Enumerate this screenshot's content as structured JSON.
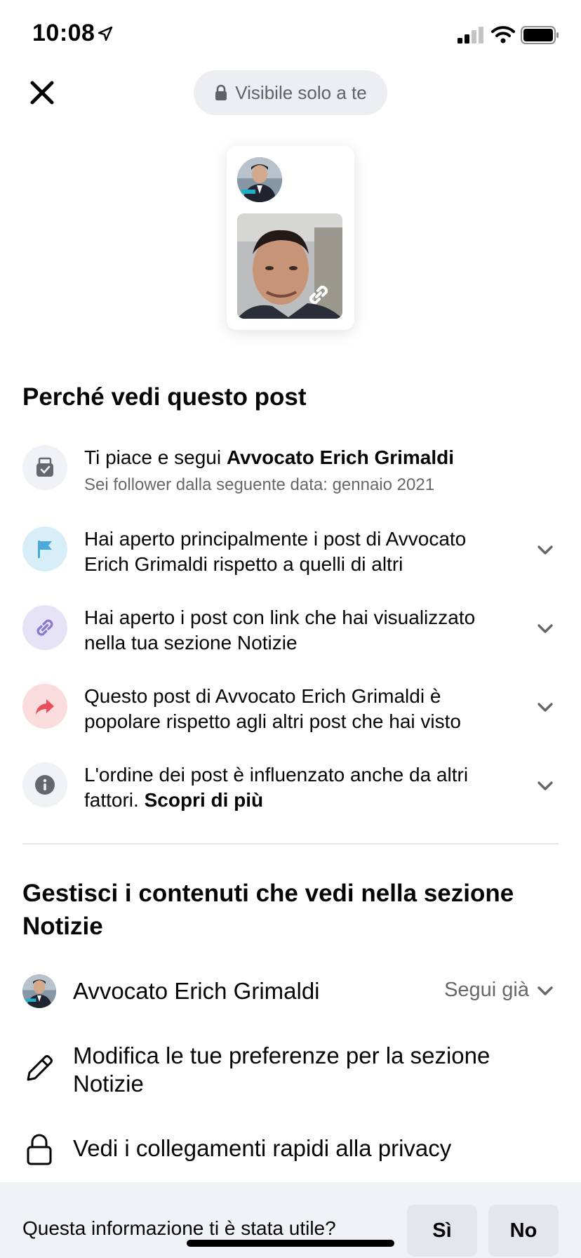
{
  "status_bar": {
    "time": "10:08",
    "icons": [
      "location-arrow-icon",
      "cellular-signal-icon",
      "wifi-icon",
      "battery-icon"
    ]
  },
  "header": {
    "close_icon": "close-icon",
    "privacy_label": "Visibile solo a te",
    "privacy_icon": "lock-icon"
  },
  "preview": {
    "link_icon": "link-icon"
  },
  "why_section": {
    "title": "Perché vedi questo post",
    "reasons": [
      {
        "icon": "like-follow-icon",
        "text_plain": "Ti piace e segui ",
        "text_bold": "Avvocato Erich Grimaldi",
        "subtext": "Sei follower dalla seguente data: gennaio 2021",
        "icon_bg": "#f0f2f5",
        "icon_color": "#65676b"
      },
      {
        "icon": "flag-icon",
        "text": "Hai aperto principalmente i post di Avvocato Erich Grimaldi rispetto a quelli di altri",
        "icon_bg": "#d7eef8",
        "icon_color": "#4aa9d6"
      },
      {
        "icon": "link-icon",
        "text": "Hai aperto i post con link che hai visualizzato nella tua sezione Notizie",
        "icon_bg": "#e7e3f6",
        "icon_color": "#8b79d0"
      },
      {
        "icon": "share-arrow-icon",
        "text": "Questo post di Avvocato Erich Grimaldi è popolare rispetto agli altri post che hai visto",
        "icon_bg": "#fadbde",
        "icon_color": "#e9505c"
      },
      {
        "icon": "info-icon",
        "text_plain": "L'ordine dei post è influenzato anche da altri fattori. ",
        "text_bold": "Scopri di più",
        "icon_bg": "#f0f2f5",
        "icon_color": "#65676b"
      }
    ]
  },
  "manage_section": {
    "title": "Gestisci i contenuti che vedi nella sezione Notizie",
    "page_row": {
      "name": "Avvocato Erich Grimaldi",
      "status": "Segui già"
    },
    "preferences_label": "Modifica le tue preferenze per la sezione Notizie",
    "privacy_shortcuts_label": "Vedi i collegamenti rapidi alla privacy"
  },
  "footer": {
    "question": "Questa informazione ti è stata utile?",
    "yes_label": "Sì",
    "no_label": "No"
  }
}
